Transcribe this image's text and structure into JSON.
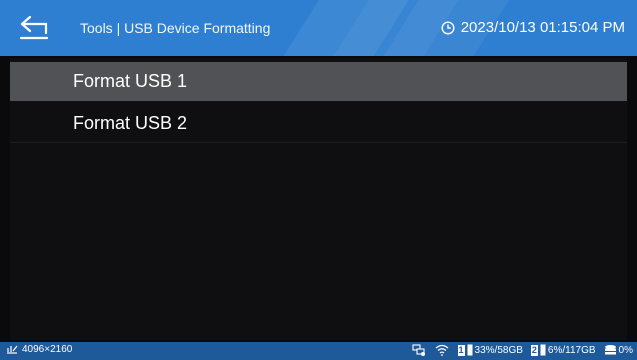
{
  "header": {
    "title": "Tools | USB Device Formatting",
    "datetime": "2023/10/13 01:15:04 PM",
    "back_icon": "back-arrow-icon",
    "clock_icon": "clock-icon",
    "bg_color": "#2e7fd1"
  },
  "list": {
    "items": [
      {
        "label": "Format USB 1",
        "selected": true
      },
      {
        "label": "Format USB 2",
        "selected": false
      }
    ],
    "selected_color": "#505255"
  },
  "status": {
    "resolution": "4096×2160",
    "resolution_icon": "signal-input-icon",
    "network_icon": "network-icon",
    "wifi_icon": "wifi-icon",
    "usb1": {
      "slot": "1",
      "usage": "33%/58GB"
    },
    "usb2": {
      "slot": "2",
      "usage": "6%/117GB"
    },
    "storage": {
      "usage": "0%",
      "icon": "storage-icon"
    },
    "bg_color": "#1e5a99"
  }
}
